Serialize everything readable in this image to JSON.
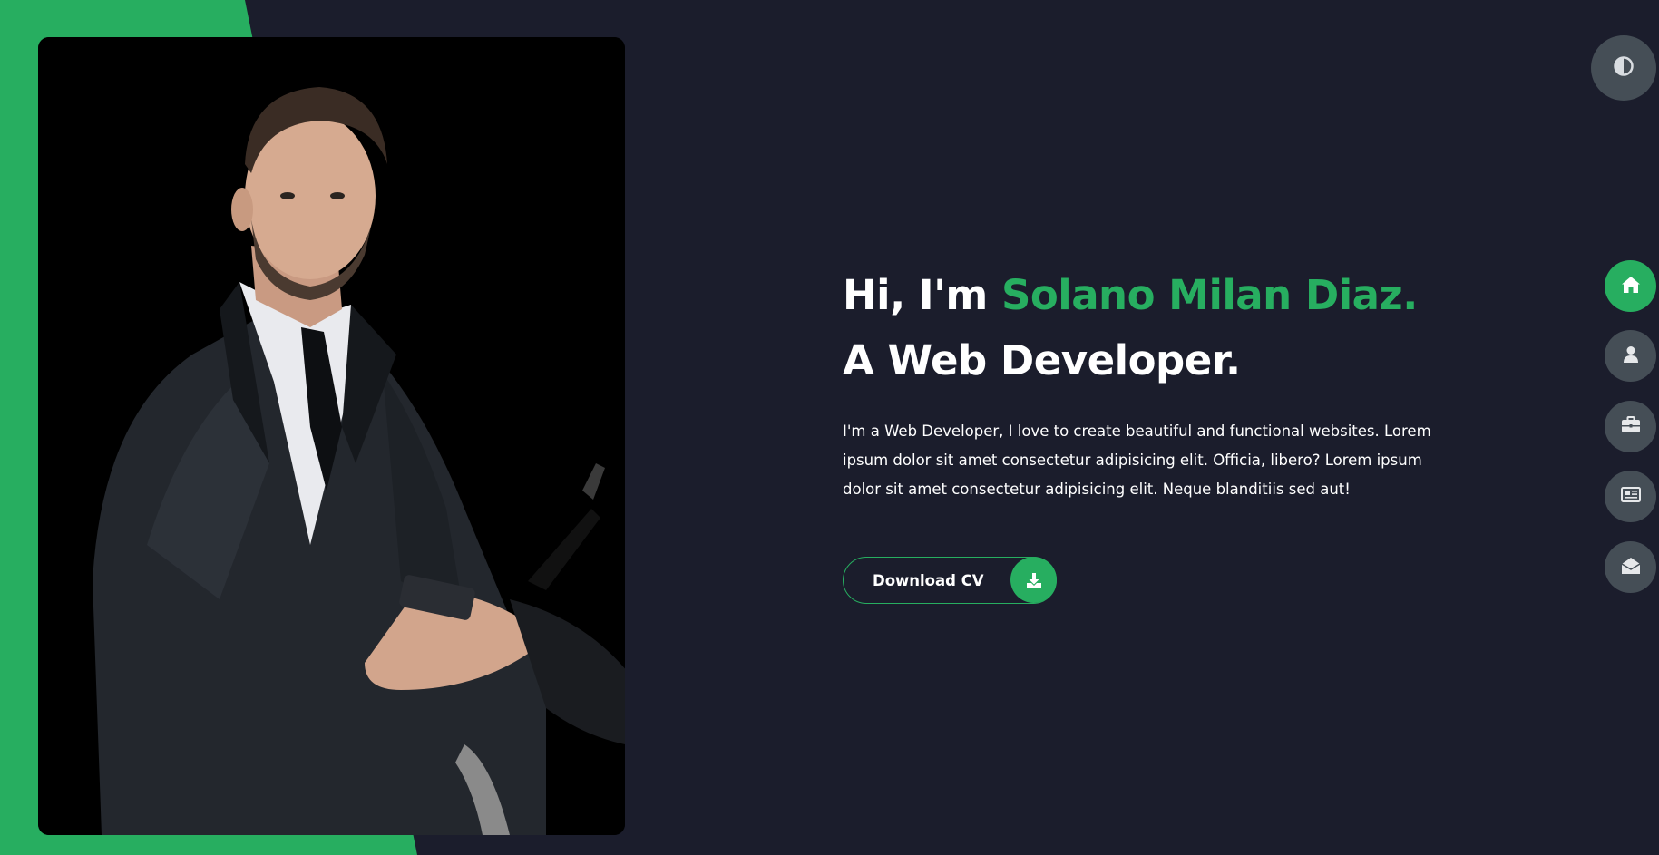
{
  "hero": {
    "greeting": "Hi, I'm ",
    "name": "Solano Milan Diaz.",
    "role": " A Web Developer.",
    "description": "I'm a Web Developer, I love to create beautiful and functional websites. Lorem ipsum dolor sit amet consectetur adipisicing elit. Officia, libero? Lorem ipsum dolor sit amet consectetur adipisicing elit. Neque blanditiis sed aut!"
  },
  "download_cv": {
    "label": "Download CV",
    "icon": "download-icon"
  },
  "theme_toggle": {
    "icon": "half-circle-contrast-icon"
  },
  "nav": {
    "items": [
      {
        "name": "home",
        "icon": "home-icon",
        "active": true
      },
      {
        "name": "about",
        "icon": "user-icon",
        "active": false
      },
      {
        "name": "portfolio",
        "icon": "briefcase-icon",
        "active": false
      },
      {
        "name": "blogs",
        "icon": "newspaper-icon",
        "active": false
      },
      {
        "name": "contact",
        "icon": "envelope-open-icon",
        "active": false
      }
    ]
  },
  "colors": {
    "background": "#1b1d2c",
    "accent": "#27ae60",
    "control_gray": "#454e56",
    "text": "#ffffff"
  }
}
